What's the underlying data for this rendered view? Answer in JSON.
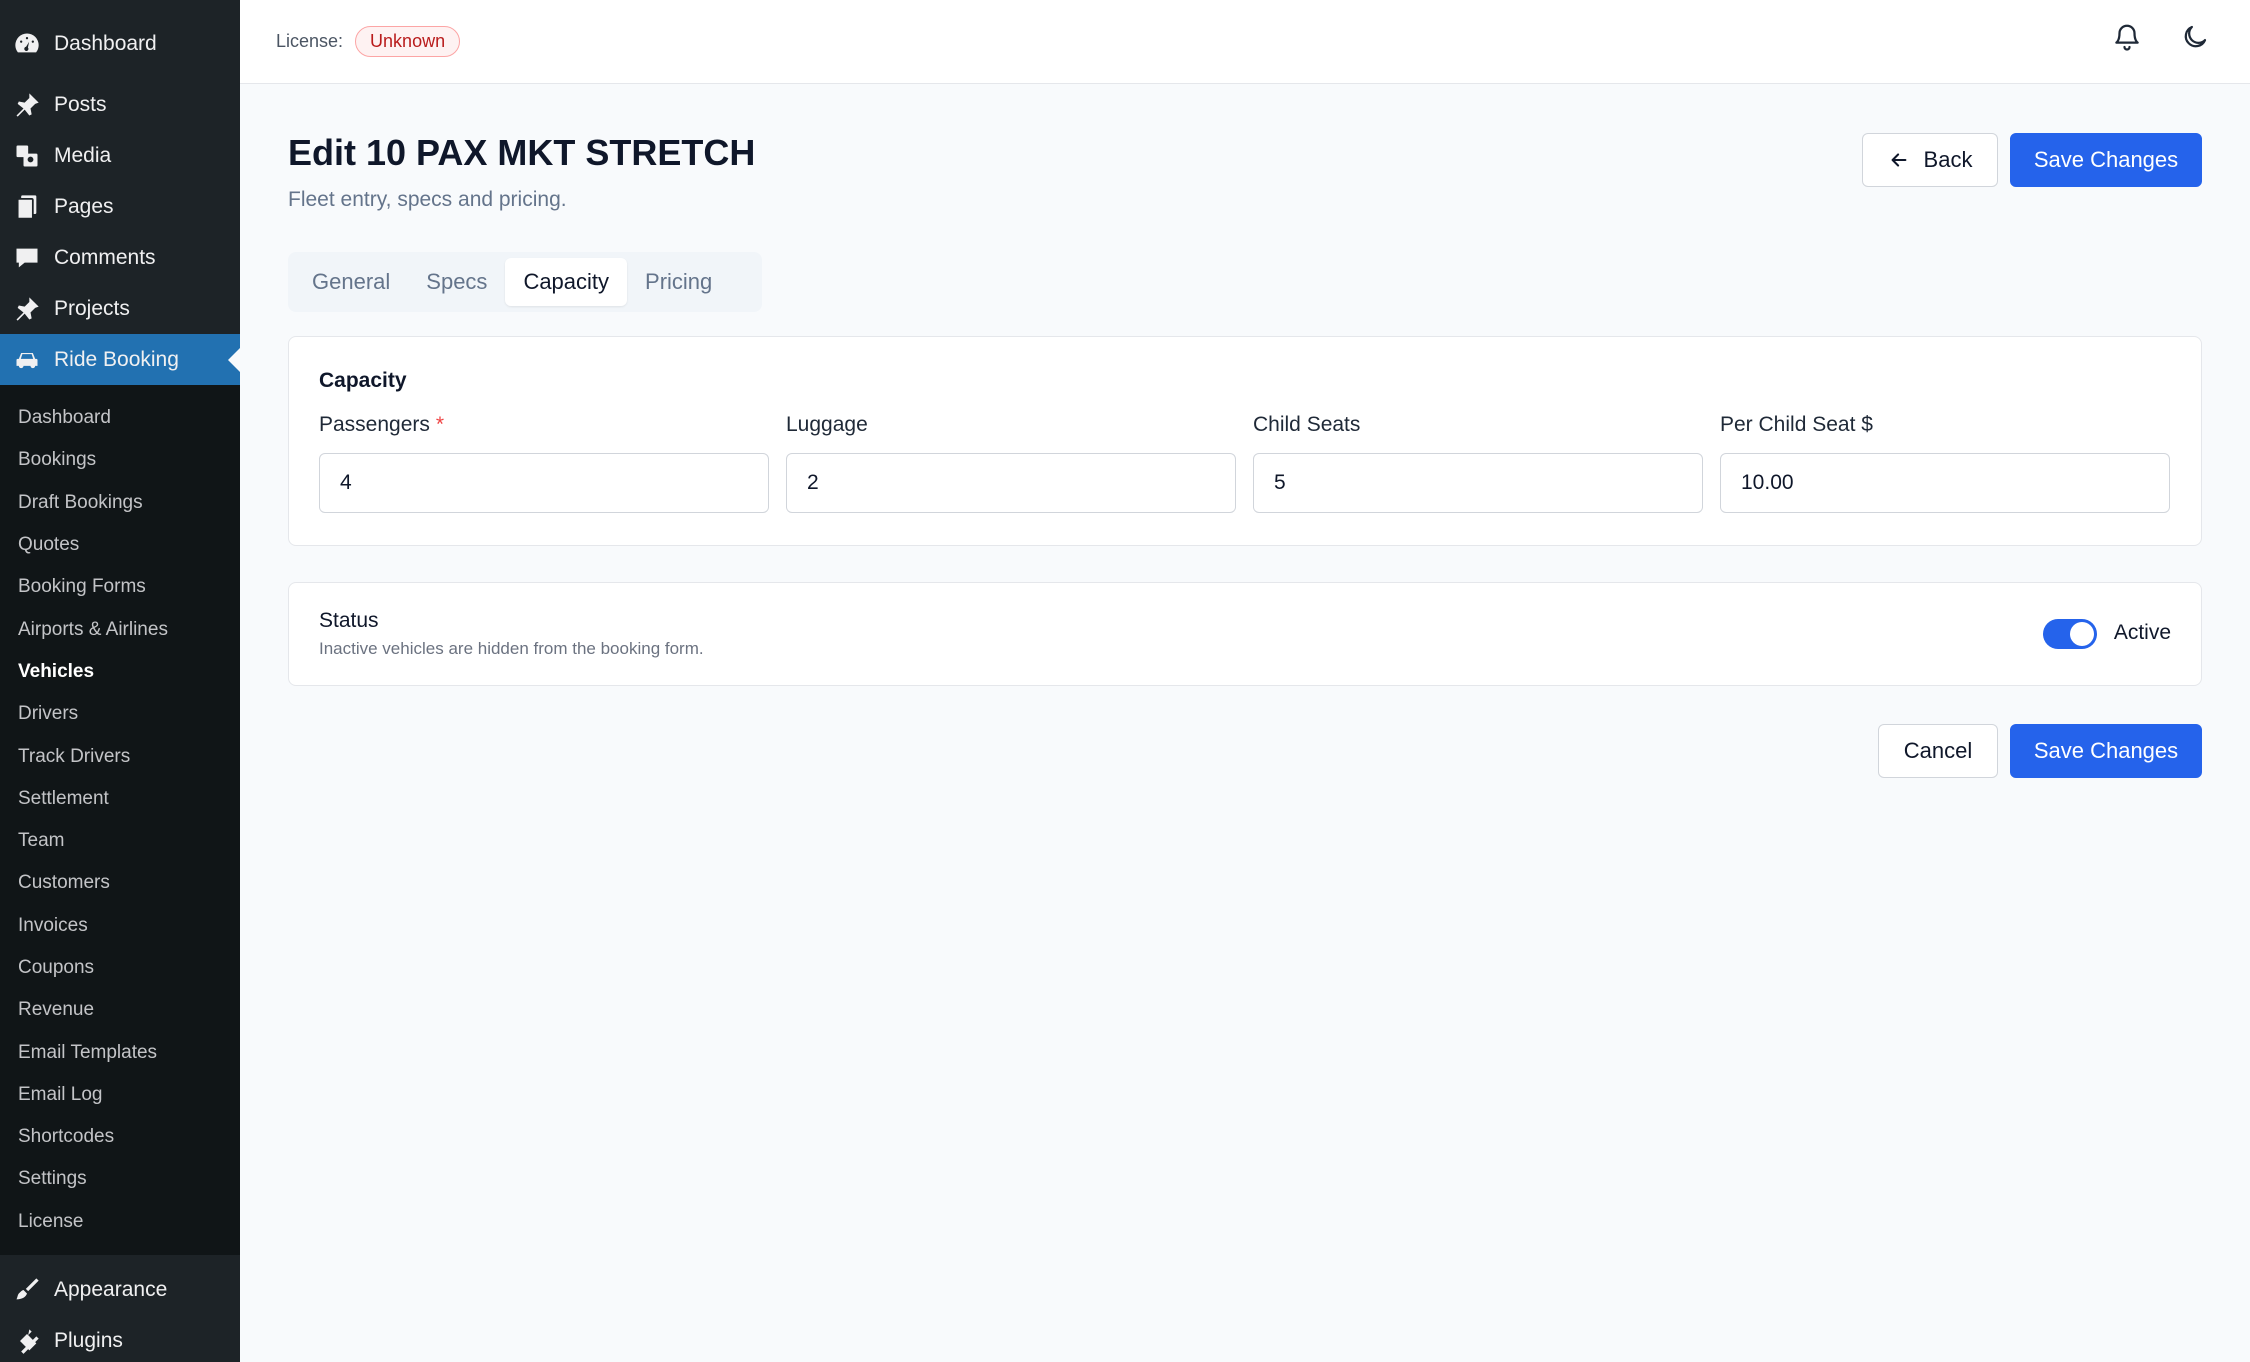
{
  "sidebar": {
    "top_items": [
      {
        "label": "Dashboard",
        "icon": "dashboard-icon"
      },
      {
        "label": "Posts",
        "icon": "pin-icon"
      },
      {
        "label": "Media",
        "icon": "media-icon"
      },
      {
        "label": "Pages",
        "icon": "pages-icon"
      },
      {
        "label": "Comments",
        "icon": "comment-icon"
      },
      {
        "label": "Projects",
        "icon": "pin-icon"
      },
      {
        "label": "Ride Booking",
        "icon": "car-icon"
      }
    ],
    "submenu": [
      "Dashboard",
      "Bookings",
      "Draft Bookings",
      "Quotes",
      "Booking Forms",
      "Airports & Airlines",
      "Vehicles",
      "Drivers",
      "Track Drivers",
      "Settlement",
      "Team",
      "Customers",
      "Invoices",
      "Coupons",
      "Revenue",
      "Email Templates",
      "Email Log",
      "Shortcodes",
      "Settings",
      "License"
    ],
    "current_sub": "Vehicles",
    "bottom_items": [
      {
        "label": "Appearance",
        "icon": "brush-icon"
      },
      {
        "label": "Plugins",
        "icon": "plugin-icon"
      }
    ]
  },
  "topbar": {
    "license_label": "License:",
    "license_status": "Unknown"
  },
  "page": {
    "title": "Edit 10 PAX MKT STRETCH",
    "subtitle": "Fleet entry, specs and pricing.",
    "back_label": "Back",
    "save_label": "Save Changes",
    "cancel_label": "Cancel"
  },
  "tabs": [
    "General",
    "Specs",
    "Capacity",
    "Pricing"
  ],
  "active_tab": "Capacity",
  "capacity": {
    "title": "Capacity",
    "fields": [
      {
        "label": "Passengers",
        "value": "4",
        "required": true
      },
      {
        "label": "Luggage",
        "value": "2",
        "required": false
      },
      {
        "label": "Child Seats",
        "value": "5",
        "required": false
      },
      {
        "label": "Per Child Seat $",
        "value": "10.00",
        "required": false
      }
    ]
  },
  "status": {
    "title": "Status",
    "description": "Inactive vehicles are hidden from the booking form.",
    "toggle_label": "Active",
    "active": true
  },
  "colors": {
    "primary": "#2563eb",
    "sidebar_bg": "#1d2327",
    "sidebar_active": "#2271b1",
    "danger": "#ef4444"
  }
}
